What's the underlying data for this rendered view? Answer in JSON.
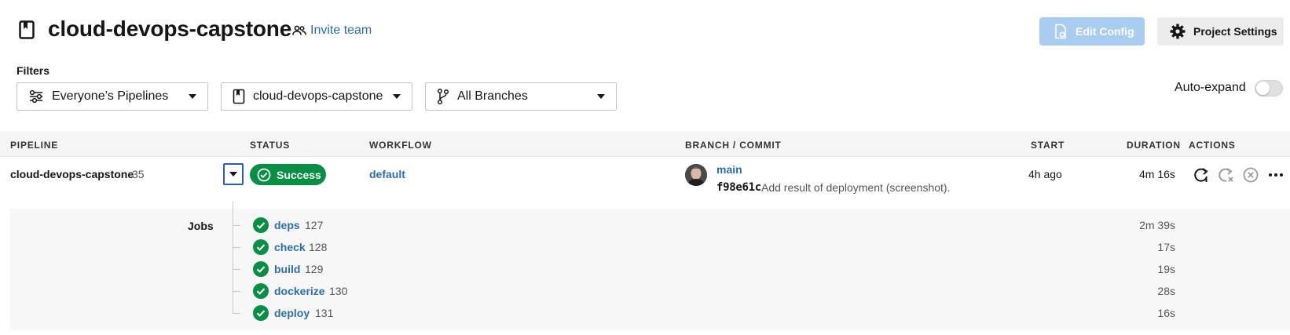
{
  "header": {
    "project_title": "cloud-devops-capstone",
    "invite_label": "Invite team",
    "edit_config_label": "Edit Config",
    "project_settings_label": "Project Settings"
  },
  "filters": {
    "label": "Filters",
    "pipelines": "Everyone’s Pipelines",
    "project": "cloud-devops-capstone",
    "branches": "All Branches"
  },
  "auto_expand": {
    "label": "Auto-expand",
    "enabled": false
  },
  "table": {
    "columns": [
      "PIPELINE",
      "STATUS",
      "WORKFLOW",
      "BRANCH / COMMIT",
      "START",
      "DURATION",
      "ACTIONS"
    ]
  },
  "pipeline": {
    "name": "cloud-devops-capstone",
    "number": "35",
    "status": "Success",
    "workflow": "default",
    "branch": "main",
    "commit_hash": "f98e61c",
    "commit_message": "Add result of deployment (screenshot).",
    "start": "4h ago",
    "duration": "4m 16s"
  },
  "jobs": {
    "label": "Jobs",
    "items": [
      {
        "name": "deps",
        "number": "127",
        "duration": "2m 39s"
      },
      {
        "name": "check",
        "number": "128",
        "duration": "17s"
      },
      {
        "name": "build",
        "number": "129",
        "duration": "19s"
      },
      {
        "name": "dockerize",
        "number": "130",
        "duration": "28s"
      },
      {
        "name": "deploy",
        "number": "131",
        "duration": "16s"
      }
    ]
  },
  "colors": {
    "link": "#2b6db3",
    "success": "#078f43",
    "edit_config_bg": "#a9cdf1",
    "settings_bg": "#ececec"
  },
  "icons": {
    "project": "bookmark-page-icon",
    "invite": "people-icon",
    "edit_config": "file-gear-icon",
    "settings": "gear-icon",
    "pipelines_filter": "filter-sliders-icon",
    "branches_filter": "git-branch-icon",
    "actions": [
      "rerun-icon",
      "rerun-failed-icon",
      "cancel-icon",
      "more-icon"
    ]
  }
}
